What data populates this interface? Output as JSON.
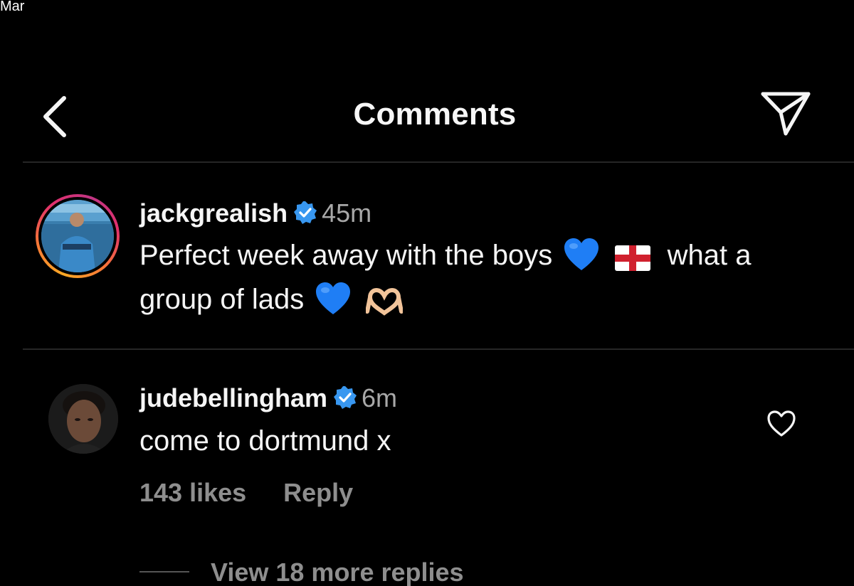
{
  "status_fragment": "Mar",
  "header": {
    "title": "Comments",
    "back_icon": "chevron-left-icon",
    "share_icon": "paper-plane-icon"
  },
  "post": {
    "username": "jackgrealish",
    "verified": true,
    "time": "45m",
    "text_line1_a": "Perfect week away with the boys",
    "text_line1_b": "what a",
    "text_line2": "group of lads",
    "emojis": [
      "blue-heart-icon",
      "england-flag-icon",
      "blue-heart-icon",
      "heart-hands-icon"
    ],
    "avatar_story_ring": true
  },
  "comment": {
    "username": "judebellingham",
    "verified": true,
    "time": "6m",
    "text": "come to dortmund x",
    "likes": "143 likes",
    "reply_label": "Reply",
    "like_icon": "heart-outline-icon"
  },
  "replies": {
    "label": "View 18 more replies"
  },
  "colors": {
    "background": "#000000",
    "verified_blue": "#3897f0",
    "secondary_text": "#a8a8a8",
    "muted_text": "#8e8e8e",
    "divider": "#262626"
  }
}
